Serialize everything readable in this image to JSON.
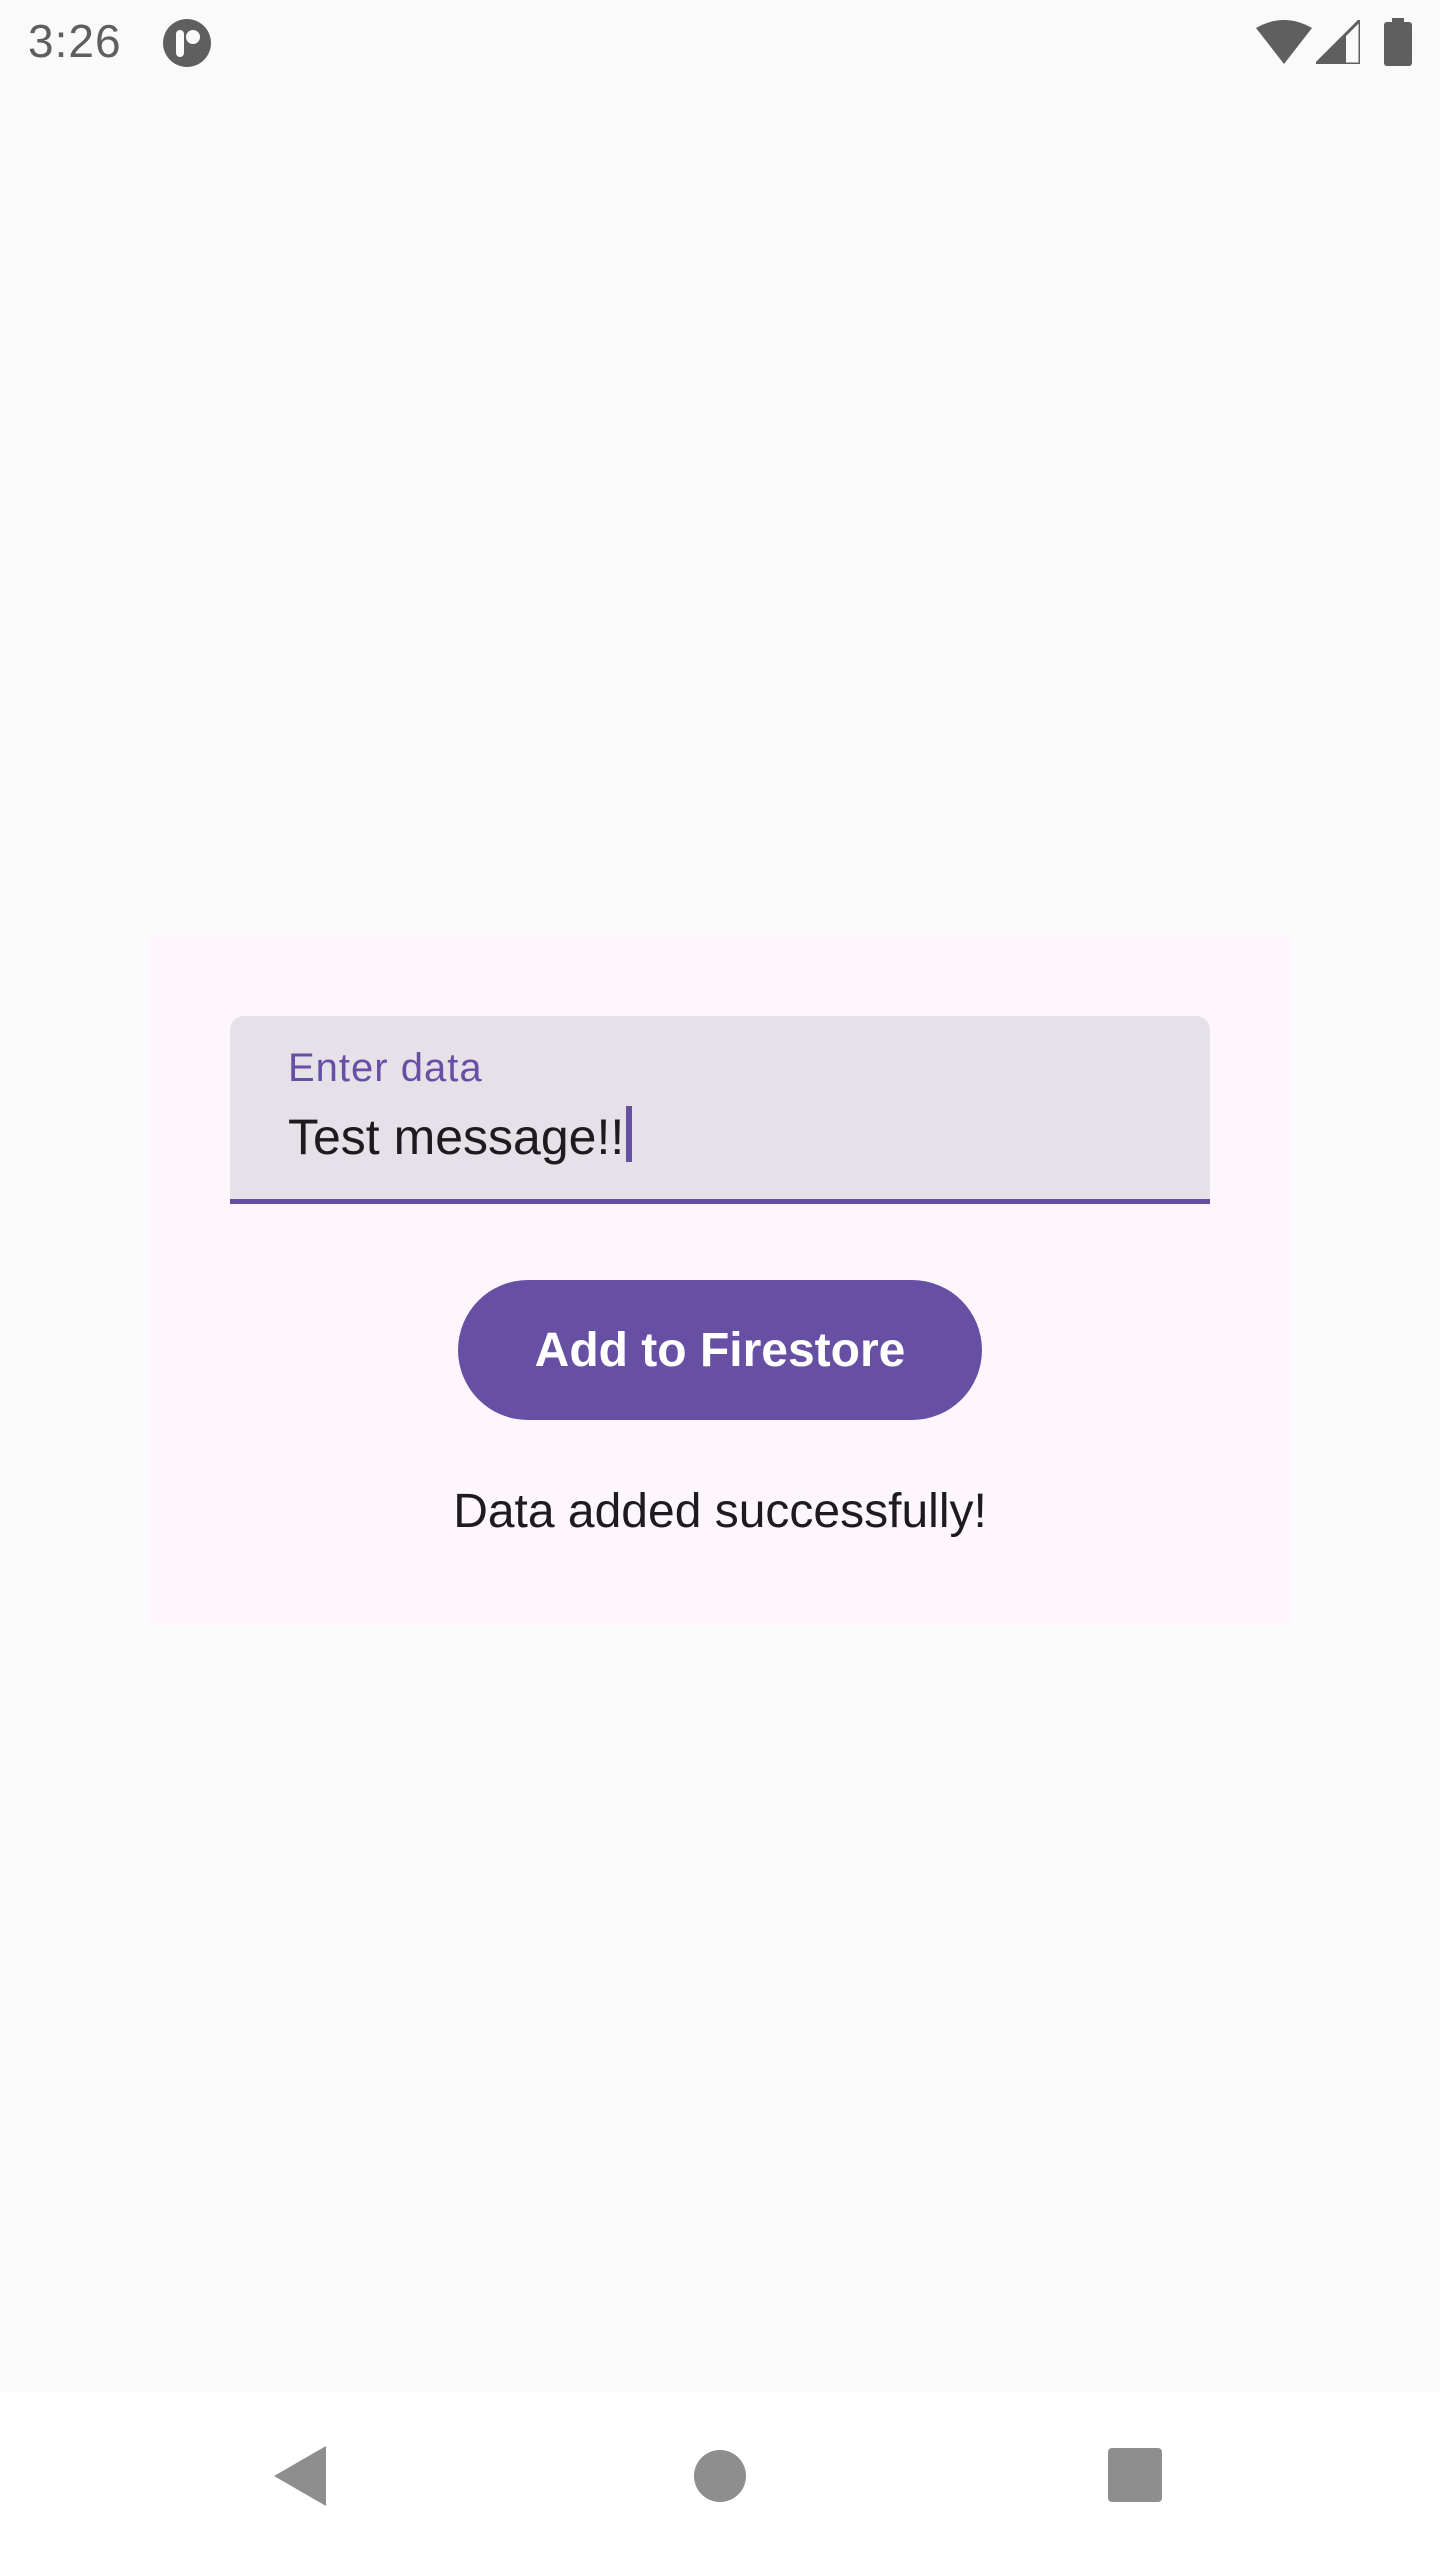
{
  "status_bar": {
    "time": "3:26",
    "icons": [
      "app-indicator-icon",
      "wifi-icon",
      "signal-icon",
      "battery-icon"
    ]
  },
  "form": {
    "field_label": "Enter data",
    "field_value": "Test message!!",
    "button_label": "Add to Firestore",
    "status_message": "Data added successfully!"
  },
  "nav_bar": {
    "icons": [
      "back-icon",
      "home-icon",
      "recents-icon"
    ]
  },
  "colors": {
    "accent": "#6750a4",
    "background": "#fafafa",
    "card_background": "#fdf6fd",
    "field_background": "#e6e0e8",
    "nav_icon": "#8e8e8e"
  }
}
